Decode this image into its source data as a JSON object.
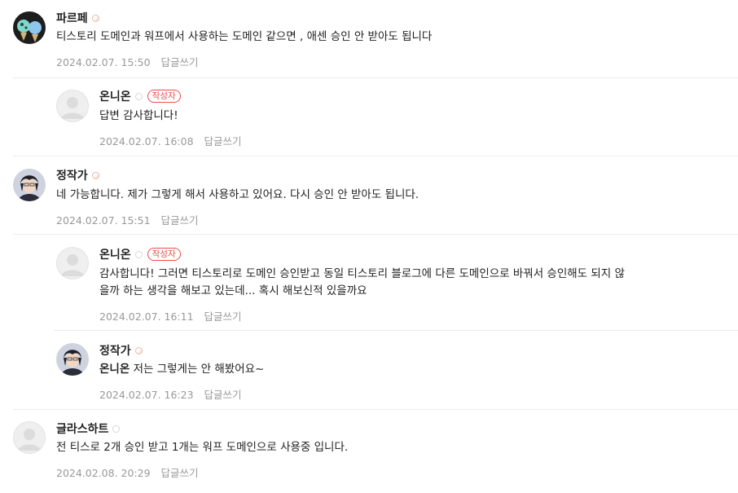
{
  "author_badge": "작성자",
  "reply_label": "답글쓰기",
  "comments": [
    {
      "name": "파르페",
      "text": "티스토리 도메인과 워프에서 사용하는 도메인 같으면 , 애센 승인 안 받아도 됩니다",
      "date": "2024.02.07. 15:50"
    },
    {
      "name": "온니온",
      "text": "답변 감사합니다!",
      "date": "2024.02.07. 16:08"
    },
    {
      "name": "정작가",
      "text": "네 가능합니다. 제가 그렇게 해서 사용하고 있어요. 다시 승인 안 받아도 됩니다.",
      "date": "2024.02.07. 15:51"
    },
    {
      "name": "온니온",
      "text_line1": "감사합니다! 그러면 티스토리로 도메인 승인받고 동일 티스토리 블로그에 다른 도메인으로 바꿔서 승인해도 되지 않",
      "text_line2": "을까 하는 생각을 해보고 있는데... 혹시 해보신적 있을까요",
      "date": "2024.02.07. 16:11"
    },
    {
      "name": "정작가",
      "mention": "온니온",
      "text": "저는 그렇게는 안 해봤어요~",
      "date": "2024.02.07. 16:23"
    },
    {
      "name": "글라스하트",
      "text": "전 티스로 2개 승인 받고 1개는 워프 도메인으로 사용중 입니다.",
      "date": "2024.02.08. 20:29"
    }
  ],
  "colors": {
    "author_badge": "#ee4b4b",
    "meta_text": "#999999",
    "divider": "#ececec"
  }
}
